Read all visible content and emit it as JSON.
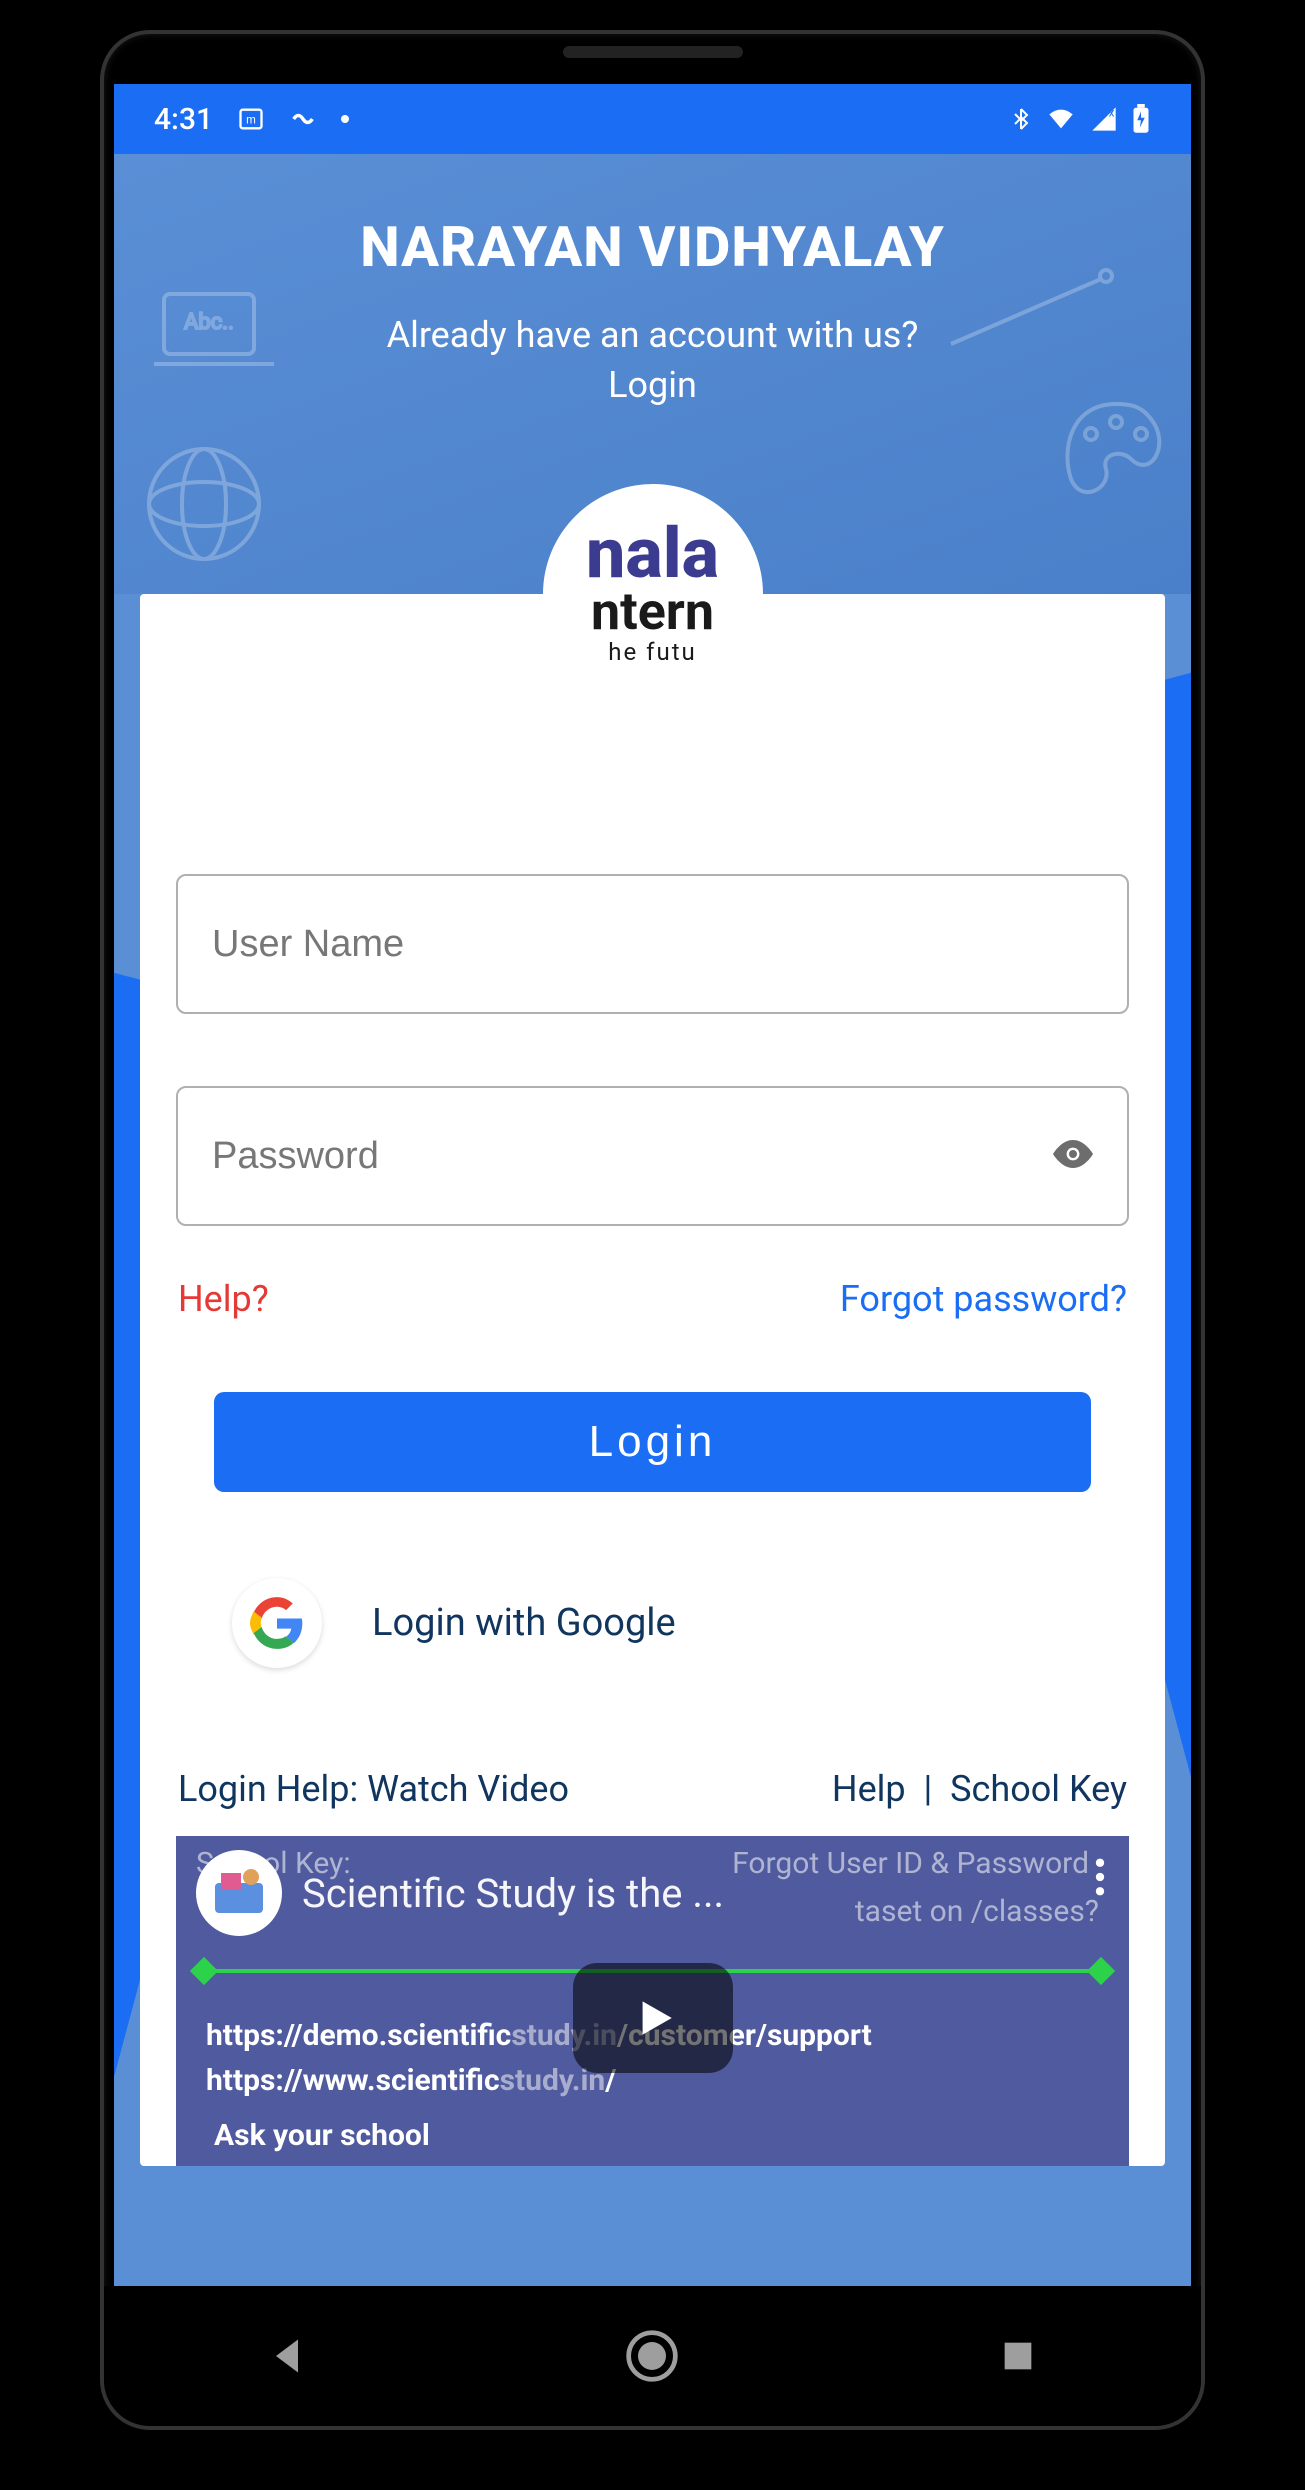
{
  "status": {
    "time": "4:31"
  },
  "header": {
    "title": "NARAYAN VIDHYALAY",
    "subtitle_line1": "Already have an account with us?",
    "subtitle_line2": "Login"
  },
  "logo": {
    "line1": "nala",
    "line2": "ntern",
    "line3": "he futu"
  },
  "form": {
    "username_placeholder": "User Name",
    "password_placeholder": "Password",
    "help_label": "Help?",
    "forgot_label": "Forgot password?",
    "login_button": "Login",
    "google_label": "Login with Google"
  },
  "secondary": {
    "watch_video": "Login Help: Watch Video",
    "help": "Help",
    "separator": "|",
    "school_key": "School Key"
  },
  "video": {
    "ghost_left_label": "School Key:",
    "ghost_right_label": "Forgot User ID & Password",
    "ghost_bottom_right": "taset on /classes?",
    "title": "Scientific Study is the ...",
    "url1_prefix": "https://demo.scientific",
    "url1_mid": "study.in",
    "url1_suffix": "/customer/support",
    "url2_prefix": "https://www.scientific",
    "url2_mid": "study.in",
    "url2_suffix": "/",
    "ask": "Ask your school"
  }
}
